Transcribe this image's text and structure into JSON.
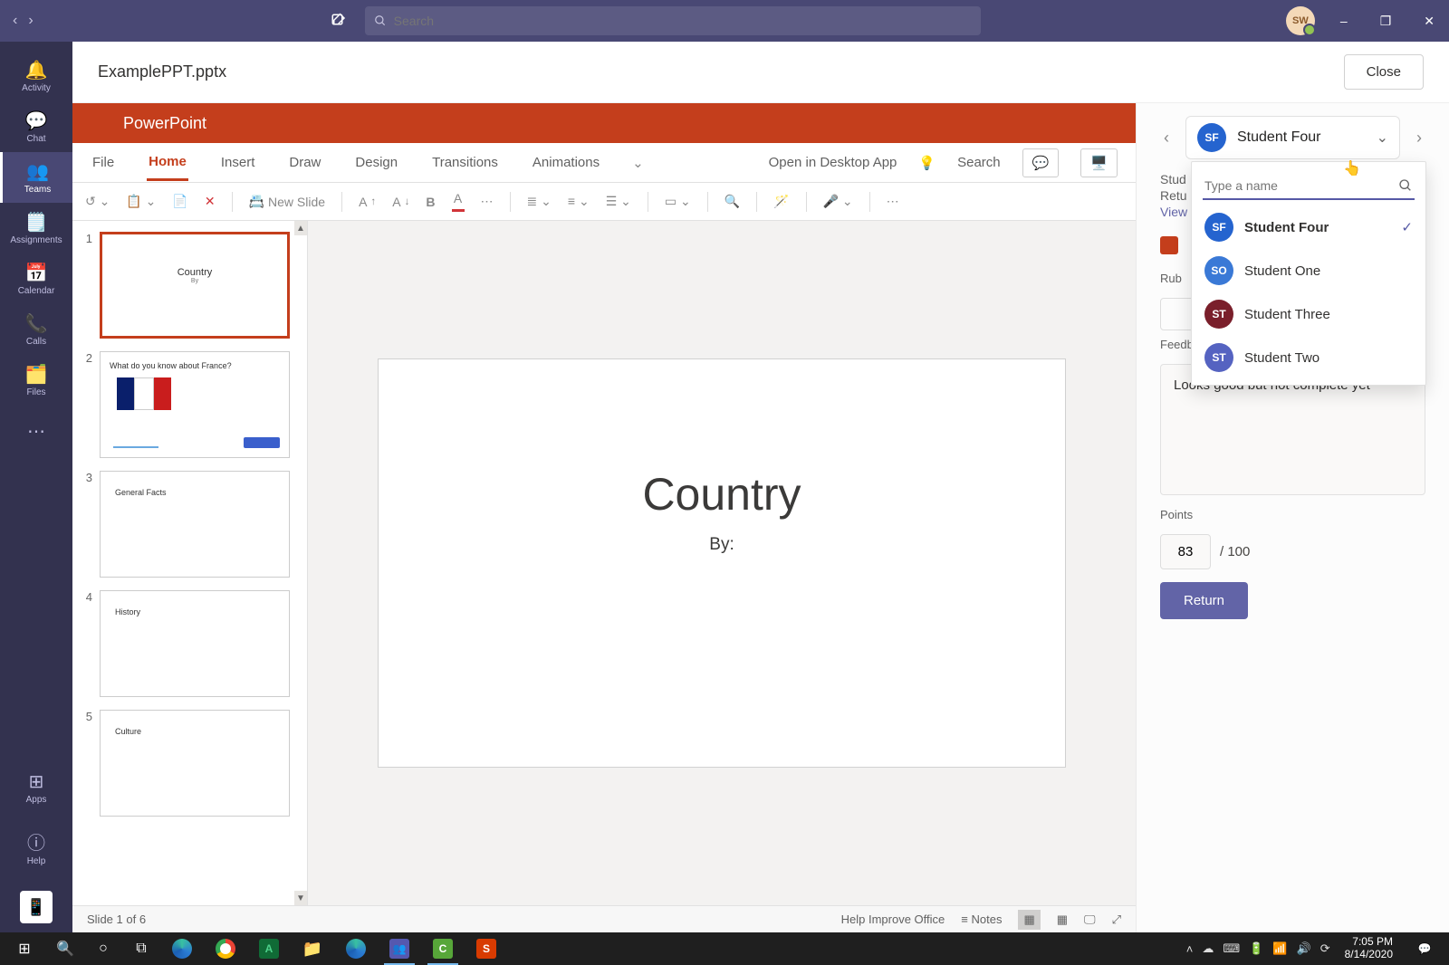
{
  "titlebar": {
    "search_placeholder": "Search",
    "avatar_initials": "SW"
  },
  "rail": {
    "activity": "Activity",
    "chat": "Chat",
    "teams": "Teams",
    "assignments": "Assignments",
    "calendar": "Calendar",
    "calls": "Calls",
    "files": "Files",
    "apps": "Apps",
    "help": "Help"
  },
  "doc": {
    "title": "ExamplePPT.pptx",
    "close": "Close"
  },
  "ppt": {
    "brand": "PowerPoint",
    "tabs": {
      "file": "File",
      "home": "Home",
      "insert": "Insert",
      "draw": "Draw",
      "design": "Design",
      "transitions": "Transitions",
      "animations": "Animations"
    },
    "open_desktop": "Open in Desktop App",
    "ribbon_search": "Search",
    "new_slide": "New Slide",
    "status_slide": "Slide 1 of 6",
    "status_help": "Help Improve Office",
    "status_notes": "Notes",
    "slide": {
      "title": "Country",
      "by": "By:"
    },
    "thumbs": [
      {
        "num": "1",
        "title": "Country",
        "sub": "By"
      },
      {
        "num": "2",
        "q": "What do you know about France?"
      },
      {
        "num": "3",
        "h": "General Facts"
      },
      {
        "num": "4",
        "h": "History"
      },
      {
        "num": "5",
        "h": "Culture"
      }
    ]
  },
  "grade": {
    "student_name": "Student Four",
    "student_initials": "SF",
    "search_placeholder": "Type a name",
    "dropdown": [
      {
        "initials": "SF",
        "name": "Student Four",
        "avatar": "av-sf",
        "selected": true
      },
      {
        "initials": "SO",
        "name": "Student One",
        "avatar": "av-so",
        "selected": false
      },
      {
        "initials": "ST",
        "name": "Student Three",
        "avatar": "av-st",
        "selected": false
      },
      {
        "initials": "ST",
        "name": "Student Two",
        "avatar": "av-s2",
        "selected": false
      }
    ],
    "label_stud": "Stud",
    "label_retu": "Retu",
    "label_view": "View",
    "label_rub": "Rub",
    "label_feedback": "Feedback",
    "feedback_text": "Looks good but not complete yet",
    "label_points": "Points",
    "points_value": "83",
    "points_max": "/ 100",
    "return_btn": "Return"
  },
  "taskbar": {
    "time": "7:05 PM",
    "date": "8/14/2020"
  }
}
